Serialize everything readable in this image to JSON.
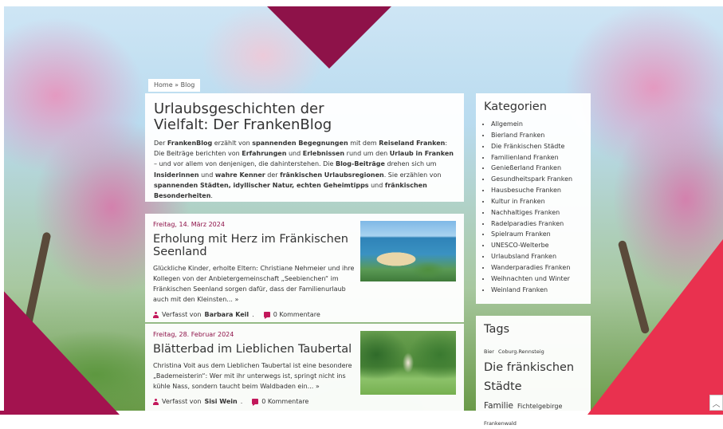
{
  "breadcrumb": {
    "home": "Home",
    "separator": "»",
    "current": "Blog"
  },
  "intro": {
    "title_line1": "Urlaubsgeschichten der",
    "title_line2": "Vielfalt: Der FrankenBlog",
    "paragraph": [
      {
        "t": "Der ",
        "b": false
      },
      {
        "t": "FrankenBlog",
        "b": true
      },
      {
        "t": " erzählt von ",
        "b": false
      },
      {
        "t": "spannenden Begegnungen",
        "b": true
      },
      {
        "t": " mit dem ",
        "b": false
      },
      {
        "t": "Reiseland Franken",
        "b": true
      },
      {
        "t": ": Die Beiträge berichten von ",
        "b": false
      },
      {
        "t": "Erfahrungen",
        "b": true
      },
      {
        "t": " und ",
        "b": false
      },
      {
        "t": "Erlebnissen",
        "b": true
      },
      {
        "t": " rund um den ",
        "b": false
      },
      {
        "t": "Urlaub in Franken",
        "b": true
      },
      {
        "t": " – und vor allem von denjenigen, die dahinterstehen. Die ",
        "b": false
      },
      {
        "t": "Blog-Beiträge",
        "b": true
      },
      {
        "t": " drehen sich um ",
        "b": false
      },
      {
        "t": "Insiderinnen",
        "b": true
      },
      {
        "t": " und ",
        "b": false
      },
      {
        "t": "wahre Ken­ner",
        "b": true
      },
      {
        "t": " der ",
        "b": false
      },
      {
        "t": "fränkischen Urlaubsregionen",
        "b": true
      },
      {
        "t": ". Sie erzählen von ",
        "b": false
      },
      {
        "t": "spannenden Städten, idyllischer Natur, echten Geheimtipps",
        "b": true
      },
      {
        "t": " und ",
        "b": false
      },
      {
        "t": "fränkischen Besonderheiten",
        "b": true
      },
      {
        "t": ".",
        "b": false
      }
    ]
  },
  "posts": [
    {
      "date": "Freitag, 14. März 2024",
      "title": "Erholung mit Herz im Fränkischen Seenland",
      "excerpt": "Glückliche Kinder, erholte Eltern: Christiane Nehmeier und ihre Kollegen von der Anbietergemeinschaft „Seebienchen“ im Fränkischen Seenland sorgen dafür, dass der Familienurlaub auch mit den Kleinsten... »",
      "author_prefix": "Verfasst von",
      "author": "Barbara Keil",
      "comments": "0 Kommentare"
    },
    {
      "date": "Freitag, 28. Februar 2024",
      "title": "Blätterbad im Lieblichen Taubertal",
      "excerpt": "Christina Voit aus dem Lieblichen Taubertal ist eine besondere „Bademeisterin“: Wer mit ihr unterwegs ist, springt nicht ins kühle Nass, sondern taucht beim Waldbaden ein... »",
      "author_prefix": "Verfasst von",
      "author": "Sisi Wein",
      "comments": "0 Kommentare"
    }
  ],
  "sidebar": {
    "categories_title": "Kategorien",
    "categories": [
      "Allgemein",
      "Bierland Franken",
      "Die Fränkischen Städte",
      "Familienland Franken",
      "Genießerland Franken",
      "Gesundheitspark Franken",
      "Hausbesuche Franken",
      "Kultur in Franken",
      "Nachhaltiges Franken",
      "Radelparadies Franken",
      "Spielraum Franken",
      "UNESCO-Welterbe",
      "Urlaubsland Franken",
      "Wanderparadies Franken",
      "Weihnachten und Winter",
      "Weinland Franken"
    ],
    "tags_title": "Tags",
    "tags": [
      {
        "label": "Bier",
        "size": "s"
      },
      {
        "label": "Coburg.Rennsteig",
        "size": "s"
      },
      {
        "label": "Die fränkischen Städte",
        "size": "l"
      },
      {
        "label": "Familie",
        "size": "m"
      },
      {
        "label": "Fichtelgebirge",
        "size": "sm"
      },
      {
        "label": "Frankenwald",
        "size": "s"
      }
    ]
  },
  "scroll_top_icon": "chevron-up-icon",
  "colors": {
    "accent": "#8e1249",
    "accent_light": "#c2185b",
    "deco_red": "#e9314f"
  }
}
